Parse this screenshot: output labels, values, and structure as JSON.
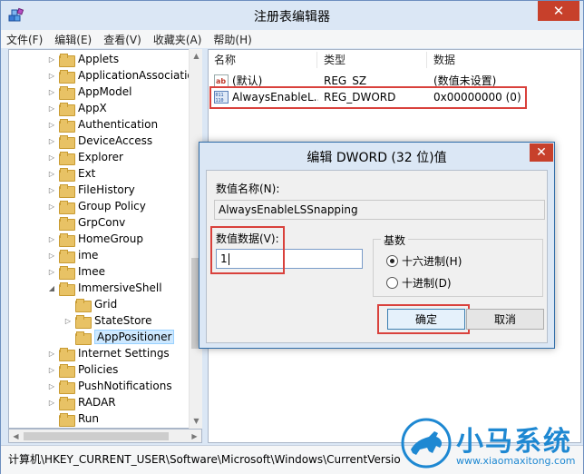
{
  "window": {
    "title": "注册表编辑器",
    "close_glyph": "✕",
    "min_glyph": "—",
    "max_glyph": "□"
  },
  "menu": [
    "文件(F)",
    "编辑(E)",
    "查看(V)",
    "收藏夹(A)",
    "帮助(H)"
  ],
  "tree": {
    "items": [
      {
        "label": "Applets",
        "level": 0,
        "expander": "collapsed"
      },
      {
        "label": "ApplicationAssociatio",
        "level": 0,
        "expander": "collapsed"
      },
      {
        "label": "AppModel",
        "level": 0,
        "expander": "collapsed"
      },
      {
        "label": "AppX",
        "level": 0,
        "expander": "collapsed"
      },
      {
        "label": "Authentication",
        "level": 0,
        "expander": "collapsed"
      },
      {
        "label": "DeviceAccess",
        "level": 0,
        "expander": "collapsed"
      },
      {
        "label": "Explorer",
        "level": 0,
        "expander": "collapsed"
      },
      {
        "label": "Ext",
        "level": 0,
        "expander": "collapsed"
      },
      {
        "label": "FileHistory",
        "level": 0,
        "expander": "collapsed"
      },
      {
        "label": "Group Policy",
        "level": 0,
        "expander": "collapsed"
      },
      {
        "label": "GrpConv",
        "level": 0,
        "expander": "none"
      },
      {
        "label": "HomeGroup",
        "level": 0,
        "expander": "collapsed"
      },
      {
        "label": "ime",
        "level": 0,
        "expander": "collapsed"
      },
      {
        "label": "Imee",
        "level": 0,
        "expander": "collapsed"
      },
      {
        "label": "ImmersiveShell",
        "level": 0,
        "expander": "expanded"
      },
      {
        "label": "Grid",
        "level": 1,
        "expander": "none"
      },
      {
        "label": "StateStore",
        "level": 1,
        "expander": "collapsed"
      },
      {
        "label": "AppPositioner",
        "level": 1,
        "expander": "none",
        "selected": true
      },
      {
        "label": "Internet Settings",
        "level": 0,
        "expander": "collapsed"
      },
      {
        "label": "Policies",
        "level": 0,
        "expander": "collapsed"
      },
      {
        "label": "PushNotifications",
        "level": 0,
        "expander": "collapsed"
      },
      {
        "label": "RADAR",
        "level": 0,
        "expander": "collapsed"
      },
      {
        "label": "Run",
        "level": 0,
        "expander": "none"
      }
    ]
  },
  "values_pane": {
    "columns": [
      "名称",
      "类型",
      "数据"
    ],
    "rows": [
      {
        "name": "(默认)",
        "type": "REG_SZ",
        "data": "(数值未设置)",
        "icon": "string-value-icon"
      },
      {
        "name": "AlwaysEnableL...",
        "type": "REG_DWORD",
        "data": "0x00000000 (0)",
        "icon": "dword-value-icon"
      }
    ]
  },
  "status": {
    "path": "计算机\\HKEY_CURRENT_USER\\Software\\Microsoft\\Windows\\CurrentVersio"
  },
  "dialog": {
    "title": "编辑 DWORD (32 位)值",
    "close_glyph": "✕",
    "value_name_label": "数值名称(N):",
    "value_name": "AlwaysEnableLSSnapping",
    "value_data_label": "数值数据(V):",
    "value_data": "1",
    "base_label": "基数",
    "base_options": [
      {
        "label": "十六进制(H)",
        "checked": true
      },
      {
        "label": "十进制(D)",
        "checked": false
      }
    ],
    "ok_label": "确定",
    "cancel_label": "取消"
  },
  "watermark": {
    "title": "小马系统",
    "url": "www.xiaomaxitong.com"
  },
  "colors": {
    "highlight_red": "#d9413c",
    "close_red": "#c7402b",
    "title_bar": "#dbe7f5",
    "watermark_blue": "#1e88d2"
  }
}
